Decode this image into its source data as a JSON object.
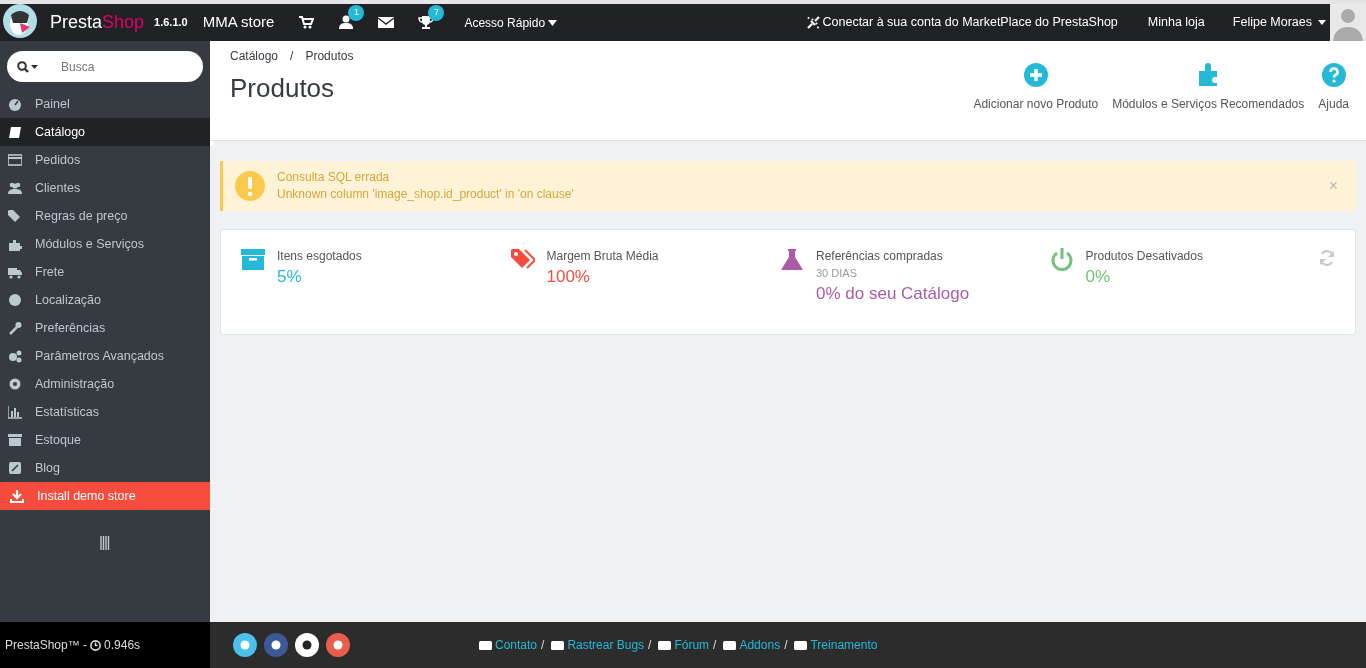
{
  "header": {
    "brand": [
      "Presta",
      "Shop"
    ],
    "version": "1.6.1.0",
    "store": "MMA store",
    "icons": [
      {
        "kind": "cart"
      },
      {
        "kind": "user",
        "badge": "1"
      },
      {
        "kind": "mail"
      },
      {
        "kind": "trophy",
        "badge": "7"
      }
    ],
    "quick_access": "Acesso Rápido",
    "marketplace": "Conectar à sua conta do MarketPlace do PrestaShop",
    "my_store": "Minha loja",
    "user": "Felipe Moraes"
  },
  "sidebar": {
    "search_placeholder": "Busca",
    "items": [
      {
        "label": "Painel",
        "selected": false,
        "kind": "normal"
      },
      {
        "label": "Catálogo",
        "selected": true,
        "kind": "normal"
      },
      {
        "label": "Pedidos",
        "selected": false,
        "kind": "normal"
      },
      {
        "label": "Clientes",
        "selected": false,
        "kind": "normal"
      },
      {
        "label": "Regras de preço",
        "selected": false,
        "kind": "normal"
      },
      {
        "label": "Módulos e Serviços",
        "selected": false,
        "kind": "normal"
      },
      {
        "label": "Frete",
        "selected": false,
        "kind": "normal"
      },
      {
        "label": "Localização",
        "selected": false,
        "kind": "normal"
      },
      {
        "label": "Preferências",
        "selected": false,
        "kind": "normal"
      },
      {
        "label": "Parâmetros Avançados",
        "selected": false,
        "kind": "normal"
      },
      {
        "label": "Administração",
        "selected": false,
        "kind": "normal"
      },
      {
        "label": "Estatísticas",
        "selected": false,
        "kind": "normal"
      },
      {
        "label": "Estoque",
        "selected": false,
        "kind": "normal"
      },
      {
        "label": "Blog",
        "selected": false,
        "kind": "normal"
      },
      {
        "label": "Install demo store",
        "selected": false,
        "kind": "demo"
      }
    ]
  },
  "page": {
    "breadcrumb": [
      "Catálogo",
      "Produtos"
    ],
    "breadcrumb_separator": "/",
    "title": "Produtos",
    "toolbar": [
      "Adicionar novo Produto",
      "Módulos e Serviços Recomendados",
      "Ajuda"
    ]
  },
  "alert": {
    "title": "Consulta SQL errada",
    "message": "Unknown column 'image_shop.id_product' in 'on clause'",
    "close": "×"
  },
  "kpis": [
    {
      "label": "Itens esgotados",
      "value": "5%",
      "color": "#25b9d7"
    },
    {
      "label": "Margem Bruta Média",
      "value": "100%",
      "color": "#f54c3e"
    },
    {
      "label": "Referências compradas",
      "sub": "30 DIAS",
      "value": "0% do seu Catálogo",
      "color": "#ab5ca6"
    },
    {
      "label": "Produtos Desativados",
      "value": "0%",
      "color": "#72c279"
    }
  ],
  "footer": {
    "version": "PrestaShop™ - ",
    "time": "0.946s",
    "links": [
      "Contato",
      "Rastrear Bugs",
      "Fórum",
      "Addons",
      "Treinamento"
    ],
    "separator": "/"
  }
}
